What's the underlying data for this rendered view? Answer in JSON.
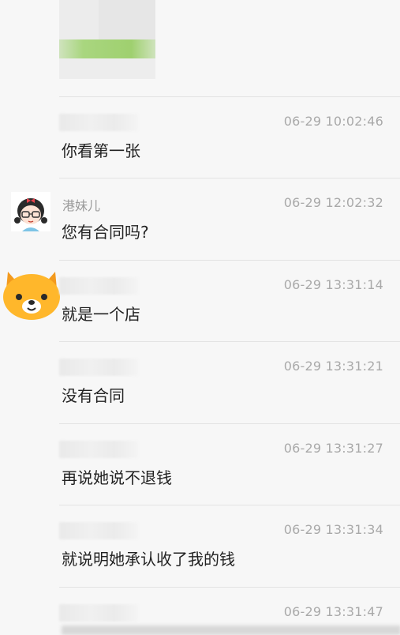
{
  "messages": [
    {
      "type": "image",
      "name": "",
      "time": "",
      "text": ""
    },
    {
      "type": "text",
      "name": "",
      "time": "06-29 10:02:46",
      "text": "你看第一张"
    },
    {
      "type": "text",
      "name": "港妹儿",
      "time": "06-29 12:02:32",
      "text": "您有合同吗?"
    },
    {
      "type": "text",
      "name": "",
      "time": "06-29 13:31:14",
      "text": "就是一个店"
    },
    {
      "type": "text",
      "name": "",
      "time": "06-29 13:31:21",
      "text": "没有合同"
    },
    {
      "type": "text",
      "name": "",
      "time": "06-29 13:31:27",
      "text": "再说她说不退钱"
    },
    {
      "type": "text",
      "name": "",
      "time": "06-29 13:31:34",
      "text": "就说明她承认收了我的钱"
    },
    {
      "type": "text",
      "name": "",
      "time": "06-29 13:31:47",
      "text": ""
    }
  ],
  "colors": {
    "background": "#f7f7f7",
    "divider": "#e3e3e3",
    "time": "#a9a9a9",
    "text": "#222222",
    "image_green": "#9fd06f",
    "bear_orange": "#ffb72b"
  },
  "icons": {
    "girl_avatar": "girl-avatar-icon",
    "bear_avatar": "bear-avatar-icon"
  }
}
